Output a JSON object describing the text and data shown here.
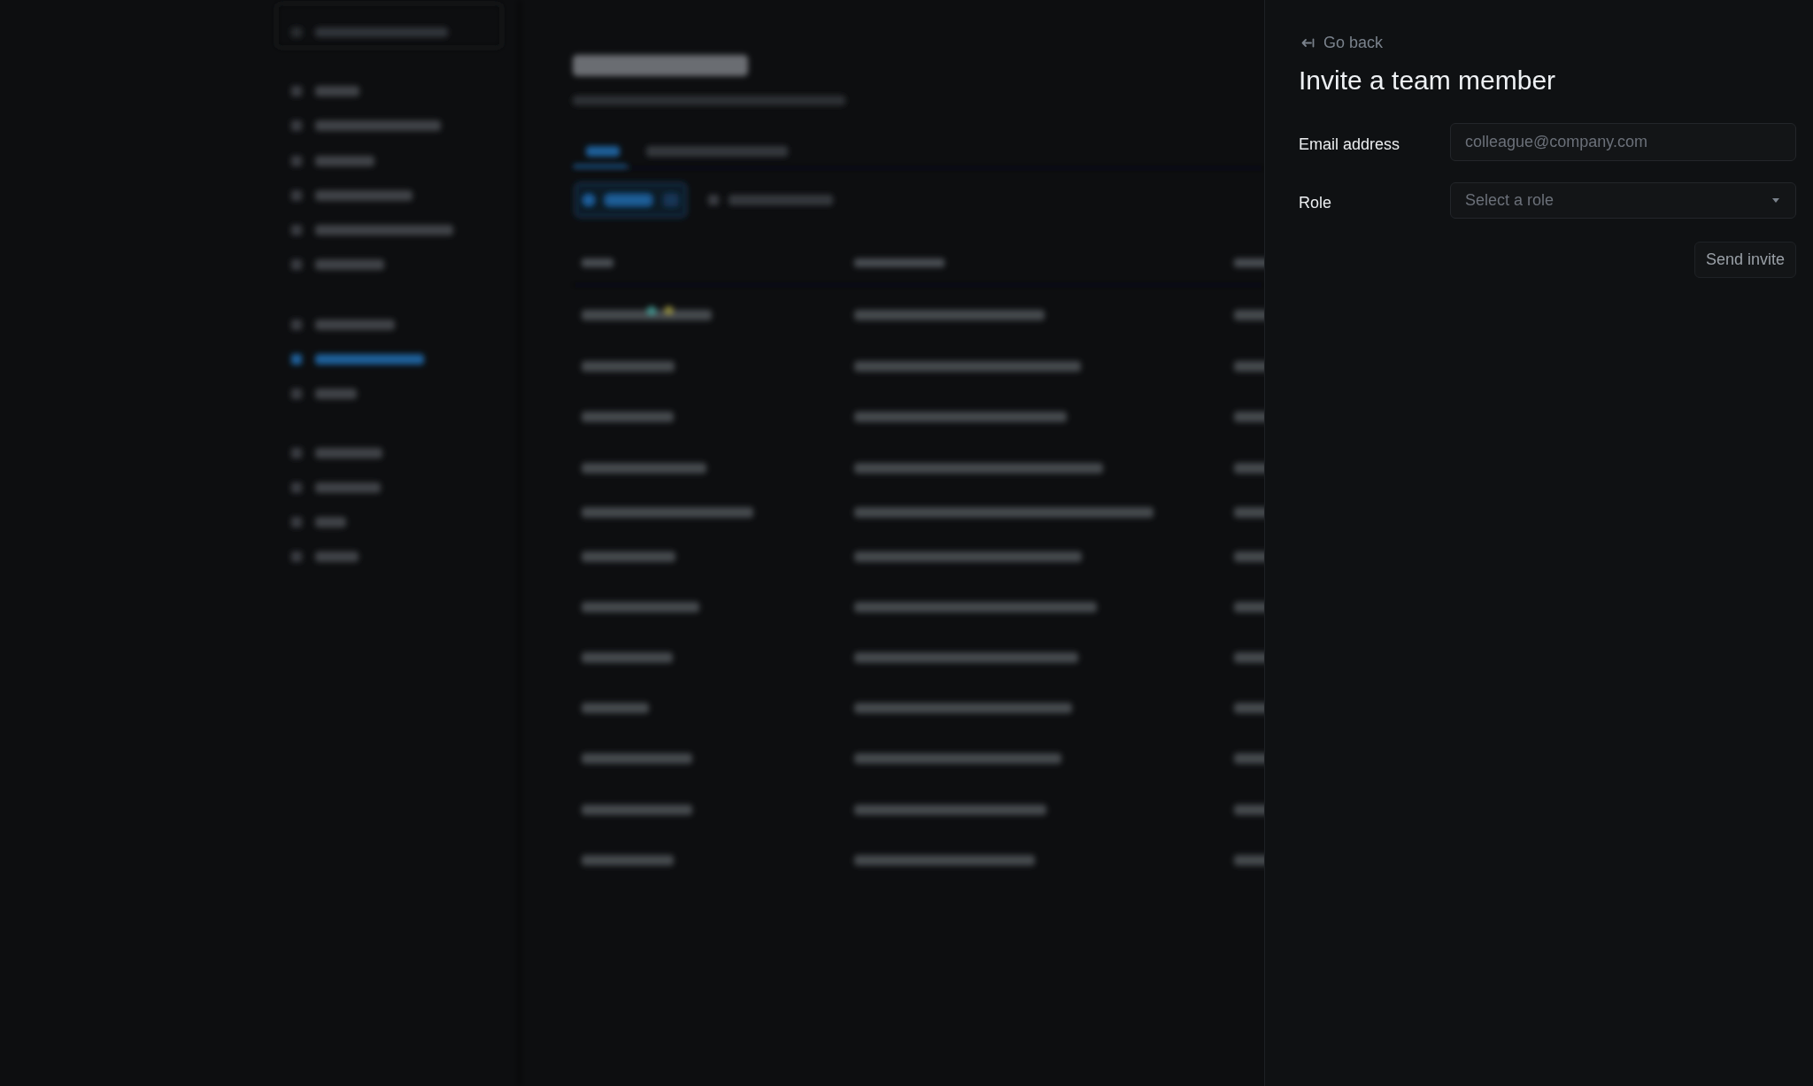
{
  "panel": {
    "back_link": "Go back",
    "title": "Invite a team member",
    "fields": [
      {
        "kind": "text",
        "label": "Email address",
        "placeholder": "colleague@company.com"
      },
      {
        "kind": "select",
        "label": "Role",
        "placeholder": "Select a role"
      }
    ],
    "submit_button": "Send invite"
  }
}
